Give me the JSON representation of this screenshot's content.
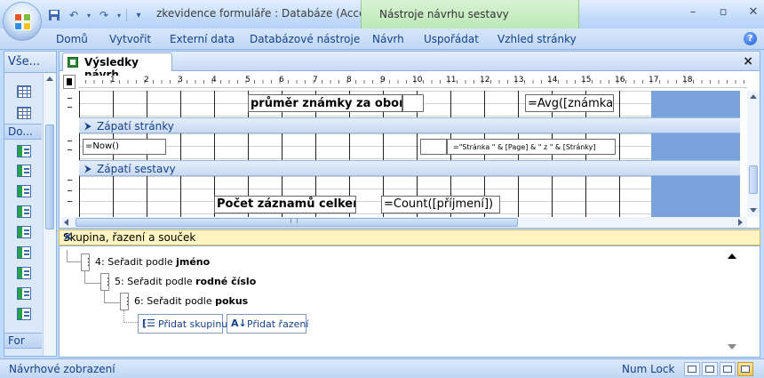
{
  "window": {
    "title": "zkevidence formuláře : Databáze (Access ... M",
    "context_tab": "Nástroje návrhu sestavy"
  },
  "ribbon": {
    "tabs": [
      "Domů",
      "Vytvořit",
      "Externí data",
      "Databázové nástroje",
      "Návrh",
      "Uspořádat",
      "Vzhled stránky"
    ]
  },
  "nav": {
    "header": "Vše...",
    "section2": "Do...",
    "section3": "For"
  },
  "document": {
    "tab_title": "Výsledky návrh",
    "ruler_numbers": [
      "1",
      "2",
      "3",
      "4",
      "5",
      "6",
      "7",
      "8",
      "9",
      "10",
      "11",
      "12",
      "13",
      "14",
      "15",
      "16",
      "17",
      "18"
    ],
    "sections": {
      "page_footer": "Zápatí stránky",
      "report_footer": "Zápatí sestavy"
    },
    "controls": {
      "avg_label": "průměr známky za obor",
      "avg_expr": "=Avg([známka])",
      "now_expr": "=Now()",
      "page_expr": "=\"Stránka \" & [Page] & \" z \" & [Stránky]",
      "count_label": "Počet záznamů celkem",
      "count_expr": "=Count([příjmení])"
    }
  },
  "group_pane": {
    "title": "Skupina, řazení a souček",
    "rows": [
      {
        "num": "4:",
        "prefix": "Seřadit podle",
        "field": "jméno"
      },
      {
        "num": "5:",
        "prefix": "Seřadit podle",
        "field": "rodné číslo"
      },
      {
        "num": "6:",
        "prefix": "Seřadit podle",
        "field": "pokus"
      }
    ],
    "add_group": "Přidat skupinu",
    "add_sort": "Přidat řazení"
  },
  "statusbar": {
    "mode": "Návrhové zobrazení",
    "numlock": "Num Lock"
  }
}
